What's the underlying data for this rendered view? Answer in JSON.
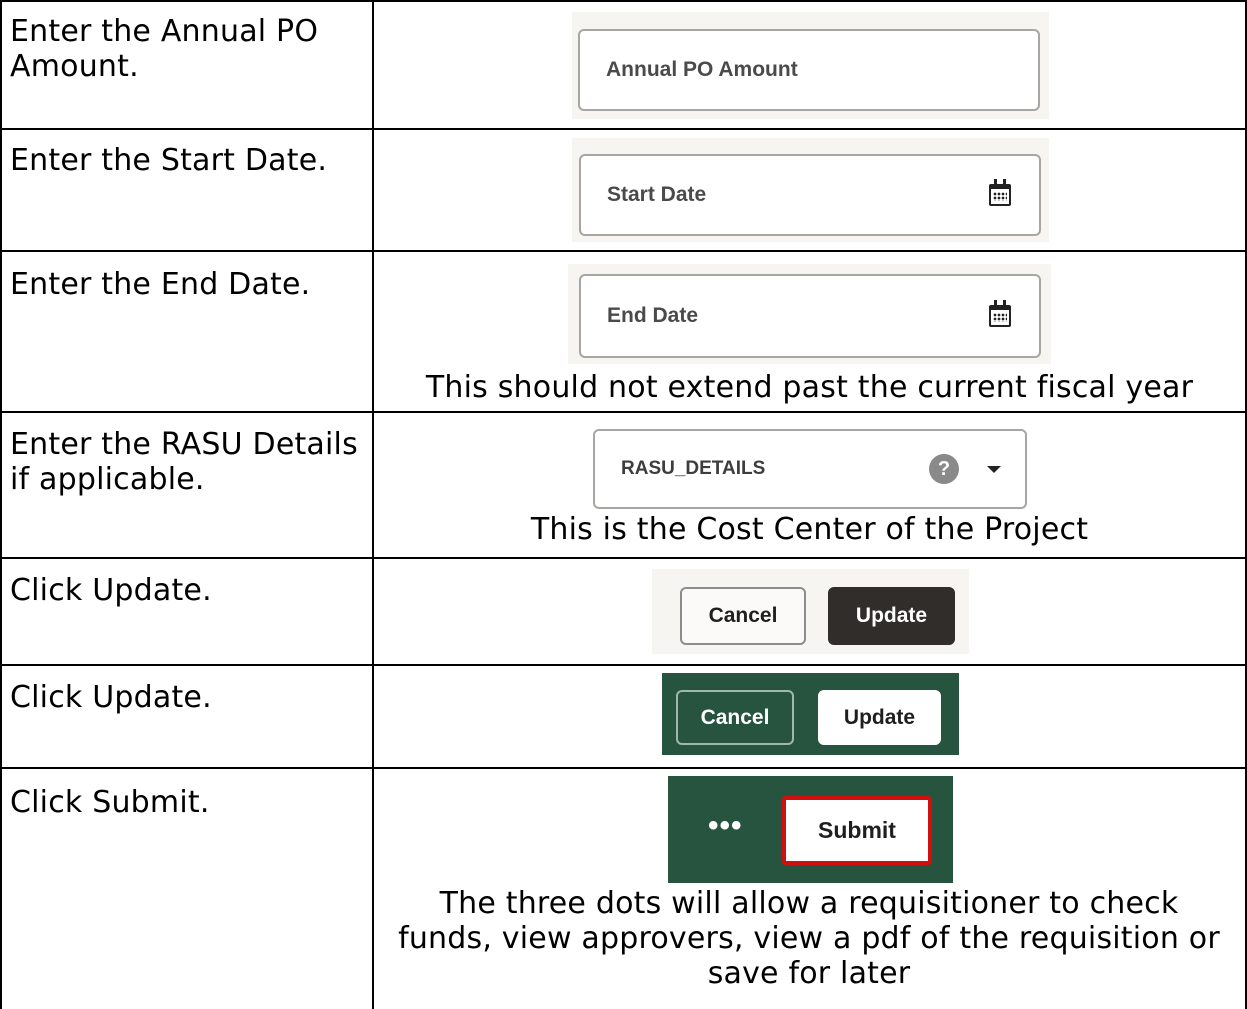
{
  "rows": [
    {
      "instruction": "Enter the Annual PO Amount.",
      "field_label": "Annual PO Amount"
    },
    {
      "instruction": "Enter the Start Date.",
      "field_label": "Start Date"
    },
    {
      "instruction": "Enter the End Date.",
      "field_label": "End Date",
      "note": "This should not extend past the current fiscal year"
    },
    {
      "instruction": "Enter the RASU Details if applicable.",
      "field_label": "RASU_DETAILS",
      "help_glyph": "?",
      "note": "This is the Cost Center of the Project"
    },
    {
      "instruction": "Click Update.",
      "cancel_label": "Cancel",
      "update_label": "Update"
    },
    {
      "instruction": "Click Update.",
      "cancel_label": "Cancel",
      "update_label": "Update"
    },
    {
      "instruction": "Click Submit.",
      "more_label": "•••",
      "submit_label": "Submit",
      "note": "The three dots will allow a requisitioner to check funds, view approvers, view a pdf of the requisition or save for later"
    }
  ],
  "icons": [
    "calendar-icon",
    "help-icon",
    "chevron-down-icon",
    "more-icon"
  ],
  "colors": {
    "panel_light": "#f7f5f2",
    "panel_green": "#27543f",
    "update_dark": "#312d2a",
    "submit_border": "#d10f0f"
  }
}
